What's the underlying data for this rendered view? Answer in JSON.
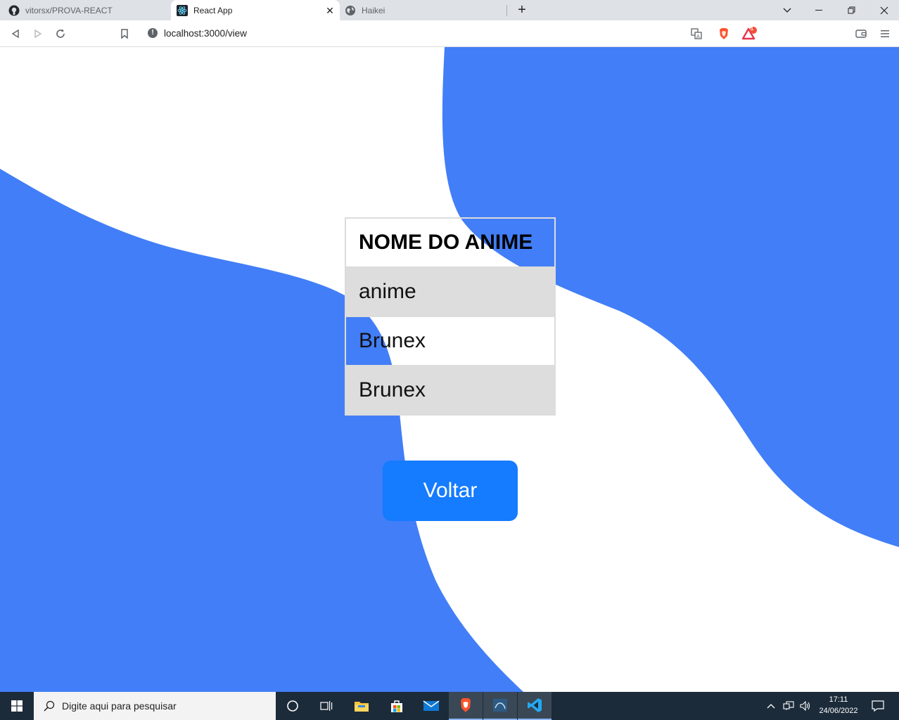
{
  "browser": {
    "tabs": [
      {
        "title": "vitorsx/PROVA-REACT"
      },
      {
        "title": "React App"
      },
      {
        "title": "Haikei"
      }
    ],
    "url": "localhost:3000/view",
    "brave_badge": "1"
  },
  "page": {
    "table": {
      "header": "NOME DO ANIME",
      "rows": [
        "anime",
        "Brunex",
        "Brunex"
      ]
    },
    "back_button": "Voltar"
  },
  "colors": {
    "blob": "#427ef7",
    "button": "#157bff",
    "row_stripe": "#dddddd"
  },
  "taskbar": {
    "search_placeholder": "Digite aqui para pesquisar",
    "time": "17:11",
    "date": "24/06/2022"
  }
}
